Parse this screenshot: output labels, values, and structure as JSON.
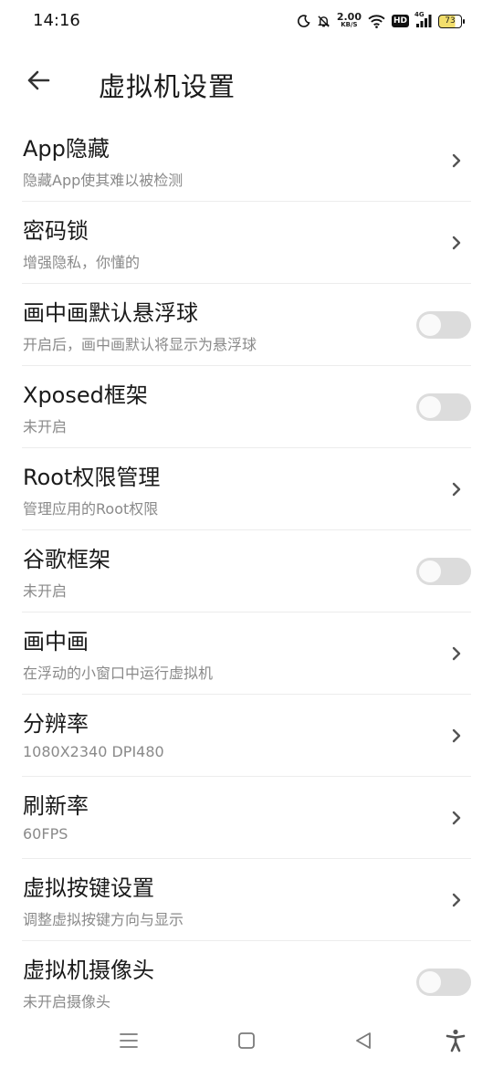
{
  "status_bar": {
    "time": "14:16",
    "net_speed_value": "2.00",
    "net_speed_unit": "KB/S",
    "hd_label": "HD",
    "network_type": "4G",
    "battery_level": "73"
  },
  "header": {
    "title": "虚拟机设置"
  },
  "settings": [
    {
      "title": "App隐藏",
      "subtitle": "隐藏App使其难以被检测",
      "control": "chevron"
    },
    {
      "title": "密码锁",
      "subtitle": "增强隐私，你懂的",
      "control": "chevron"
    },
    {
      "title": "画中画默认悬浮球",
      "subtitle": "开启后，画中画默认将显示为悬浮球",
      "control": "toggle",
      "on": false
    },
    {
      "title": "Xposed框架",
      "subtitle": "未开启",
      "control": "toggle",
      "on": false
    },
    {
      "title": "Root权限管理",
      "subtitle": "管理应用的Root权限",
      "control": "chevron"
    },
    {
      "title": "谷歌框架",
      "subtitle": "未开启",
      "control": "toggle",
      "on": false
    },
    {
      "title": "画中画",
      "subtitle": "在浮动的小窗口中运行虚拟机",
      "control": "chevron"
    },
    {
      "title": "分辨率",
      "subtitle": "1080X2340 DPI480",
      "control": "chevron"
    },
    {
      "title": "刷新率",
      "subtitle": "60FPS",
      "control": "chevron"
    },
    {
      "title": "虚拟按键设置",
      "subtitle": "调整虚拟按键方向与显示",
      "control": "chevron"
    },
    {
      "title": "虚拟机摄像头",
      "subtitle": "未开启摄像头",
      "control": "toggle",
      "on": false
    }
  ],
  "icons": {
    "back": "arrow-left-icon",
    "chevron": "chevron-right-icon",
    "nav_menu": "menu-icon",
    "nav_home": "square-home-icon",
    "nav_back": "triangle-back-icon",
    "nav_accessibility": "accessibility-icon"
  },
  "colors": {
    "toggle_off": "#dcdcdc",
    "subtitle": "#8a8a8a"
  }
}
